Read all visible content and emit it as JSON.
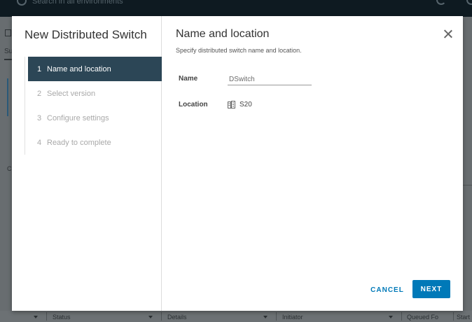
{
  "background": {
    "search_placeholder": "Search in all environments",
    "left_tab_fragment": "Su",
    "left_panel_fragment": "C",
    "tasks_columns": [
      {
        "label": "Status"
      },
      {
        "label": "Details"
      },
      {
        "label": "Initiator"
      },
      {
        "label": "Queued Fo"
      },
      {
        "label": "Start"
      }
    ]
  },
  "wizard": {
    "title": "New Distributed Switch",
    "steps": [
      {
        "number": "1",
        "label": "Name and location",
        "active": true
      },
      {
        "number": "2",
        "label": "Select version",
        "active": false
      },
      {
        "number": "3",
        "label": "Configure settings",
        "active": false
      },
      {
        "number": "4",
        "label": "Ready to complete",
        "active": false
      }
    ],
    "page": {
      "title": "Name and location",
      "subtitle": "Specify distributed switch name and location.",
      "fields": {
        "name_label": "Name",
        "name_value": "DSwitch",
        "location_label": "Location",
        "location_value": "S20",
        "location_icon": "datacenter-icon"
      }
    },
    "buttons": {
      "cancel": "CANCEL",
      "next": "NEXT"
    },
    "colors": {
      "active_step_bg": "#2c4656",
      "primary": "#0079b8"
    }
  }
}
